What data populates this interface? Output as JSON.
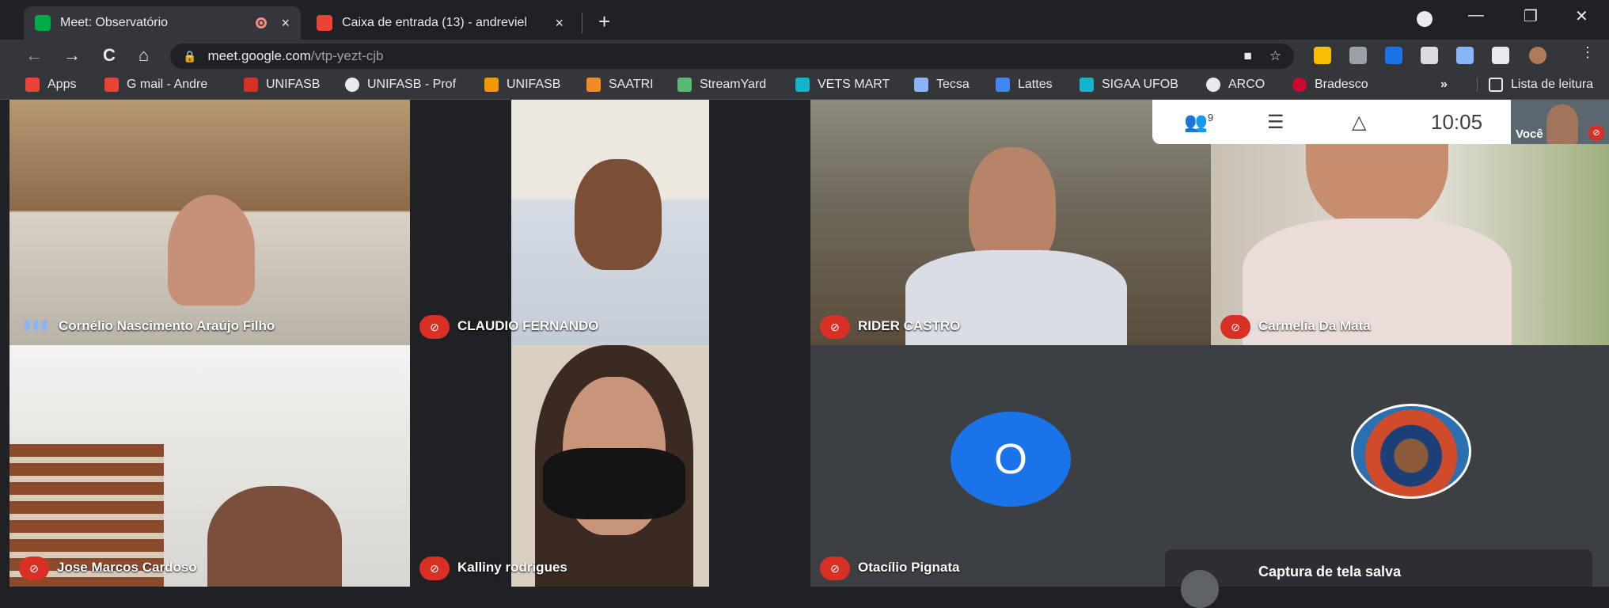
{
  "tabs": [
    {
      "title": "Meet: Observatório",
      "favicon_color": "#00ac47",
      "recording_icon": "recording-icon",
      "close": "×"
    },
    {
      "title": "Caixa de entrada (13) - andreviel",
      "favicon_color": "#ea4335",
      "close": "×"
    }
  ],
  "new_tab": "+",
  "window_controls": {
    "minimize": "—",
    "restore": "❐",
    "close": "✕"
  },
  "nav": {
    "back": "←",
    "forward": "→",
    "reload": "C",
    "home": "⌂"
  },
  "address": {
    "host": "meet.google.com",
    "path": "/vtp-yezt-cjb"
  },
  "bookmarks": [
    {
      "label": "Apps",
      "color": "#ea4335"
    },
    {
      "label": "G mail - Andre",
      "color": "#ea4335"
    },
    {
      "label": "UNIFASB",
      "color": "#d93025"
    },
    {
      "label": "UNIFASB - Prof",
      "color": "#e8eaed"
    },
    {
      "label": "UNIFASB",
      "color": "#f29900"
    },
    {
      "label": "SAATRI",
      "color": "#f28b26"
    },
    {
      "label": "StreamYard",
      "color": "#5bb974"
    },
    {
      "label": "VETS MART",
      "color": "#12b5cb"
    },
    {
      "label": "Tecsa",
      "color": "#8ab4f8"
    },
    {
      "label": "Lattes",
      "color": "#4285f4"
    },
    {
      "label": "SIGAA UFOB",
      "color": "#12b5cb"
    },
    {
      "label": "ARCO",
      "color": "#e8eaed"
    },
    {
      "label": "Bradesco",
      "color": "#cc092f"
    }
  ],
  "bookmarks_more": "»",
  "reading_list": "Lista de leitura",
  "meet": {
    "participants_badge": "9",
    "time": "10:05",
    "self_label": "Você",
    "tiles": [
      {
        "name": "Cornélio Nascimento Araújo Filho",
        "speaking": true
      },
      {
        "name": "CLAUDIO FERNANDO",
        "speaking": false
      },
      {
        "name": "RIDER CASTRO",
        "speaking": false
      },
      {
        "name": "Carmelia Da Mata",
        "speaking": false
      },
      {
        "name": "Jose Marcos Cardoso",
        "speaking": false
      },
      {
        "name": "Kalliny rodrigues",
        "speaking": false
      },
      {
        "name": "Otacílio Pignata",
        "speaking": false,
        "avatar_letter": "O"
      }
    ],
    "toast": "Captura de tela salva"
  }
}
